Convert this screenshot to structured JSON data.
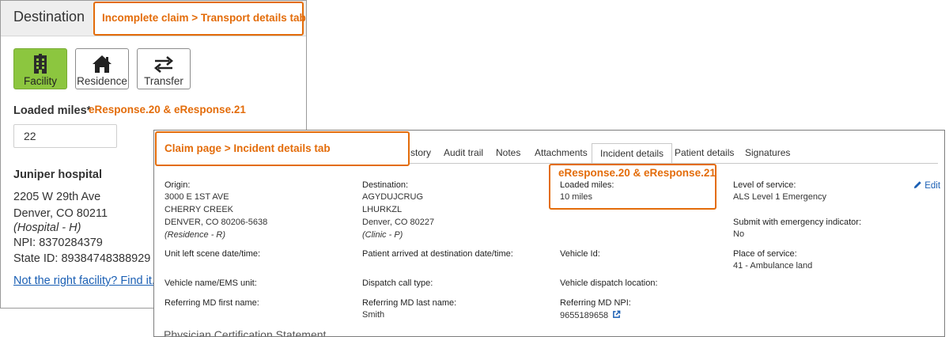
{
  "transport_panel": {
    "title": "Destination",
    "buttons": [
      {
        "label": "Facility",
        "icon": "building-icon",
        "active": true
      },
      {
        "label": "Residence",
        "icon": "house-icon",
        "active": false
      },
      {
        "label": "Transfer",
        "icon": "transfer-arrows-icon",
        "active": false
      }
    ],
    "loaded_miles_label": "Loaded miles*",
    "loaded_miles_value": "22",
    "facility_name": "Juniper hospital",
    "address_line1": "2205 W 29th Ave",
    "address_line2": "Denver, CO 80211",
    "facility_type": "(Hospital - H)",
    "npi": "NPI: 8370284379",
    "state_id": "State ID: 89384748388929",
    "facility_link": "Not the right facility? Find it."
  },
  "incident_panel": {
    "tabs": [
      "story",
      "Audit trail",
      "Notes",
      "Attachments",
      "Incident details",
      "Patient details",
      "Signatures"
    ],
    "active_tab": "Incident details",
    "edit_label": "Edit",
    "origin": {
      "label": "Origin:",
      "lines": [
        "3000 E 1ST AVE",
        "CHERRY CREEK",
        "DENVER, CO 80206-5638"
      ],
      "type": "(Residence - R)"
    },
    "destination": {
      "label": "Destination:",
      "lines": [
        "AGYDUJCRUG",
        "LHURKZL",
        "Denver, CO 80227"
      ],
      "type": "(Clinic - P)"
    },
    "loaded_miles": {
      "label": "Loaded miles:",
      "value": "10 miles"
    },
    "level_of_service": {
      "label": "Level of service:",
      "value": "ALS Level 1 Emergency"
    },
    "emergency_indicator": {
      "label": "Submit with emergency indicator:",
      "value": "No"
    },
    "unit_left_scene": {
      "label": "Unit left scene date/time:"
    },
    "patient_arrived": {
      "label": "Patient arrived at destination date/time:"
    },
    "vehicle_id": {
      "label": "Vehicle Id:"
    },
    "place_of_service": {
      "label": "Place of service:",
      "value": "41 - Ambulance land"
    },
    "vehicle_name": {
      "label": "Vehicle name/EMS unit:"
    },
    "dispatch_call_type": {
      "label": "Dispatch call type:"
    },
    "vehicle_dispatch_location": {
      "label": "Vehicle dispatch location:"
    },
    "referring_first": {
      "label": "Referring MD first name:"
    },
    "referring_last": {
      "label": "Referring MD last name:",
      "value": "Smith"
    },
    "referring_npi": {
      "label": "Referring MD NPI:",
      "value": "9655189658"
    },
    "section_heading": "Physician Certification Statement"
  },
  "annotations": {
    "transport_tab": "Incomplete claim > Transport details tab",
    "transport_eresponse": "eResponse.20 & eResponse.21",
    "incident_tab": "Claim page > Incident details tab",
    "incident_eresponse": "eResponse.20 & eResponse.21"
  },
  "colors": {
    "accent_orange": "#e36c0a",
    "active_green": "#8cc63f",
    "link_blue": "#1a5fb4"
  }
}
